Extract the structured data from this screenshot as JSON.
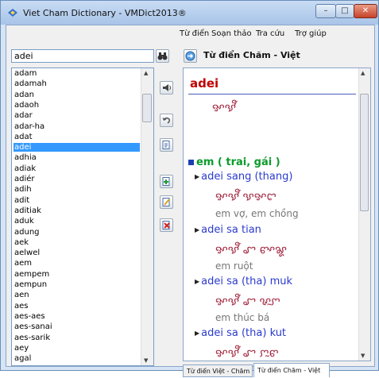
{
  "window": {
    "title": "Viet Cham Dictionary - VMDict2013®"
  },
  "menu": {
    "items": [
      "Từ điển",
      "Soạn thảo",
      "Tra cứu",
      "Trợ giúp"
    ]
  },
  "search": {
    "value": "adei"
  },
  "panel": {
    "title": "Từ điển Chăm - Việt"
  },
  "wordlist": {
    "selected": "adei",
    "items": [
      "adam",
      "adamah",
      "adan",
      "adaoh",
      "adar",
      "adar-ha",
      "adat",
      "adei",
      "adhia",
      "adiak",
      "adiér",
      "adih",
      "adit",
      "aditiak",
      "aduk",
      "adung",
      "aek",
      "aelwel",
      "aem",
      "aempem",
      "aempun",
      "aen",
      "aes",
      "aes-aes",
      "aes-sanai",
      "aes-sarik",
      "aey",
      "agal"
    ]
  },
  "entry": {
    "headword": "adei",
    "cham": "ꨀꨕꨬ",
    "sense": "em ( trai, gái )",
    "phrases": [
      {
        "text": "adei sang (thang)",
        "cham": "ꨀꨕꨬ ꨕꨀꨤ",
        "meaning": "em vợ, em chồng"
      },
      {
        "text": "adei sa tian",
        "cham": "ꨀꨕꨬ ꨧ ꨓꨳꨘ",
        "meaning": "em ruột"
      },
      {
        "text": "adei sa (tha) muk",
        "cham": "ꨀꨕꨬ ꨧ ꨟꨭꨆ",
        "meaning": "em thúc bá"
      },
      {
        "text": "adei sa (tha) kut",
        "cham": "ꨀꨕꨬ ꨧ ꨆꨭꨓ"
      }
    ]
  },
  "tabs": [
    "Từ điển Việt - Chăm",
    "Từ điển Chăm - Việt"
  ],
  "colors": {
    "selection": "#3399ff",
    "headword": "#c00000",
    "sense": "#0a9b2a",
    "phrase": "#2a3acf"
  }
}
